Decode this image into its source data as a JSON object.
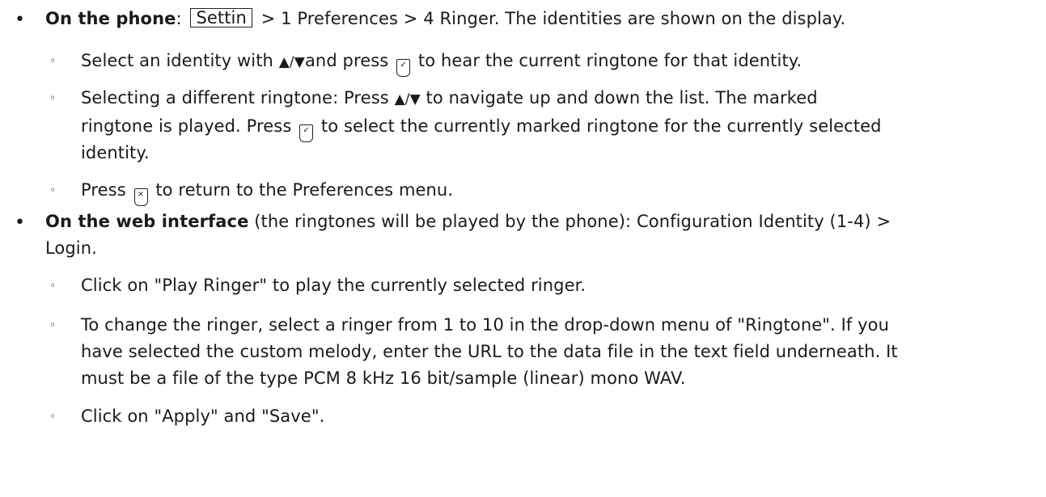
{
  "bullets": {
    "phone": {
      "label": "On the phone",
      "colon": ":",
      "key": "Settin",
      "path": "> 1 Preferences > 4 Ringer.  The identities are shown on the display.",
      "subs": [
        {
          "pre": "Select an identity with ",
          "arrows": "▲/▼",
          "mid": "and press ",
          "post": " to hear the current ringtone for that identity."
        },
        {
          "line1_pre": "Selecting a different ringtone:  Press ",
          "arrows": "▲/▼",
          "line1_post": " to navigate up and down the list.  The marked",
          "line2_pre": "ringtone is played.  Press ",
          "line2_post": " to select the currently marked ringtone for the currently selected",
          "line3": "identity."
        },
        {
          "pre": "Press ",
          "post": " to return to the Preferences menu."
        }
      ]
    },
    "web": {
      "label": "On the web interface",
      "line1_rest": " (the ringtones will be played by the phone):  Configuration Identity (1-4) >",
      "line2": "Login.",
      "subs": [
        {
          "text": "Click on \"Play Ringer\" to play the currently selected ringer."
        },
        {
          "line1": "To change the ringer, select a ringer from 1 to 10 in the drop-down menu of \"Ringtone\".  If you",
          "line2": "have selected the custom melody, enter the URL to the data file in the text field underneath.  It",
          "line3": "must be a file of the type PCM 8 kHz 16 bit/sample (linear) mono WAV."
        },
        {
          "text": "Click on \"Apply\" and \"Save\"."
        }
      ]
    }
  },
  "icons": {
    "ok_key": "check-key-icon",
    "cancel_key": "cancel-key-icon",
    "ok_glyph": "✓",
    "cancel_glyph": "×"
  }
}
